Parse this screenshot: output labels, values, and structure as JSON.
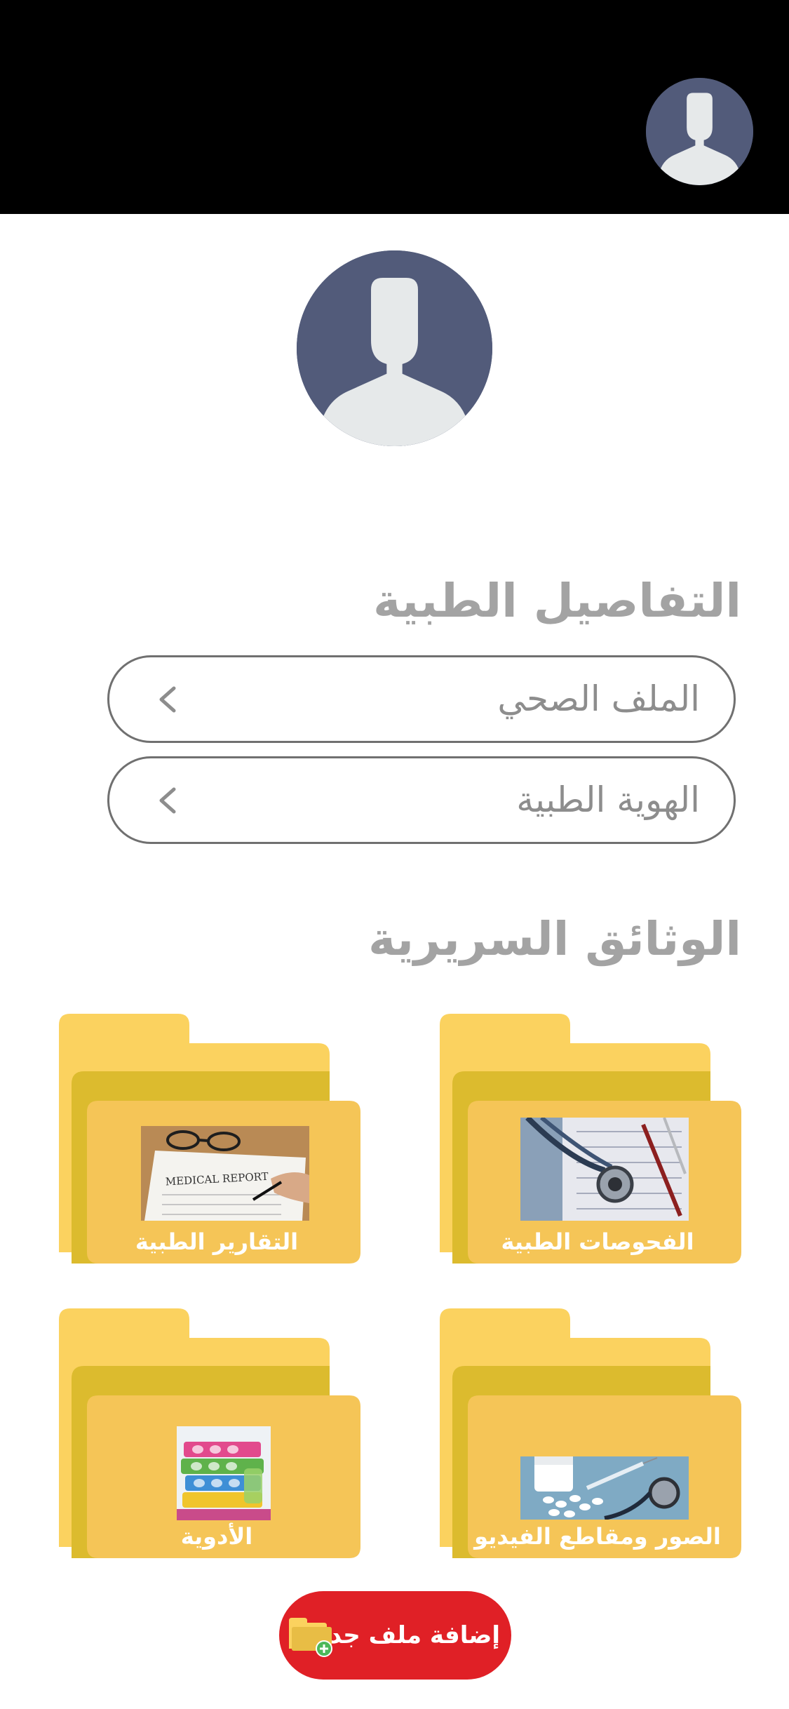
{
  "header": {
    "avatar_icon": "user-avatar-icon"
  },
  "profile": {
    "avatar_icon": "user-avatar-icon"
  },
  "medical_details": {
    "title": "التفاصيل الطبية",
    "items": [
      {
        "label": "الملف الصحي",
        "icon": "chevron-left-icon"
      },
      {
        "label": "الهوية الطبية",
        "icon": "chevron-left-icon"
      }
    ]
  },
  "clinical_documents": {
    "title": "الوثائق السريرية",
    "folders": [
      {
        "label": "الفحوصات الطبية",
        "image": "stethoscope-report-photo"
      },
      {
        "label": "التقارير الطبية",
        "image": "medical-report-photo"
      },
      {
        "label": "الصور ومقاطع الفيديو",
        "image": "pills-syringe-photo"
      },
      {
        "label": "الأدوية",
        "image": "medicine-blister-photo"
      }
    ]
  },
  "add_button": {
    "label": "إضافة ملف جديد",
    "icon": "add-folder-icon"
  },
  "colors": {
    "header_bg": "#000000",
    "avatar_bg": "#525b7a",
    "avatar_silhouette": "#e6e9ea",
    "heading_text": "#a3a3a3",
    "folder_light": "#fbd25f",
    "folder_dark": "#dcbb2e",
    "folder_front": "#f5c557",
    "add_button_bg": "#e02026"
  }
}
